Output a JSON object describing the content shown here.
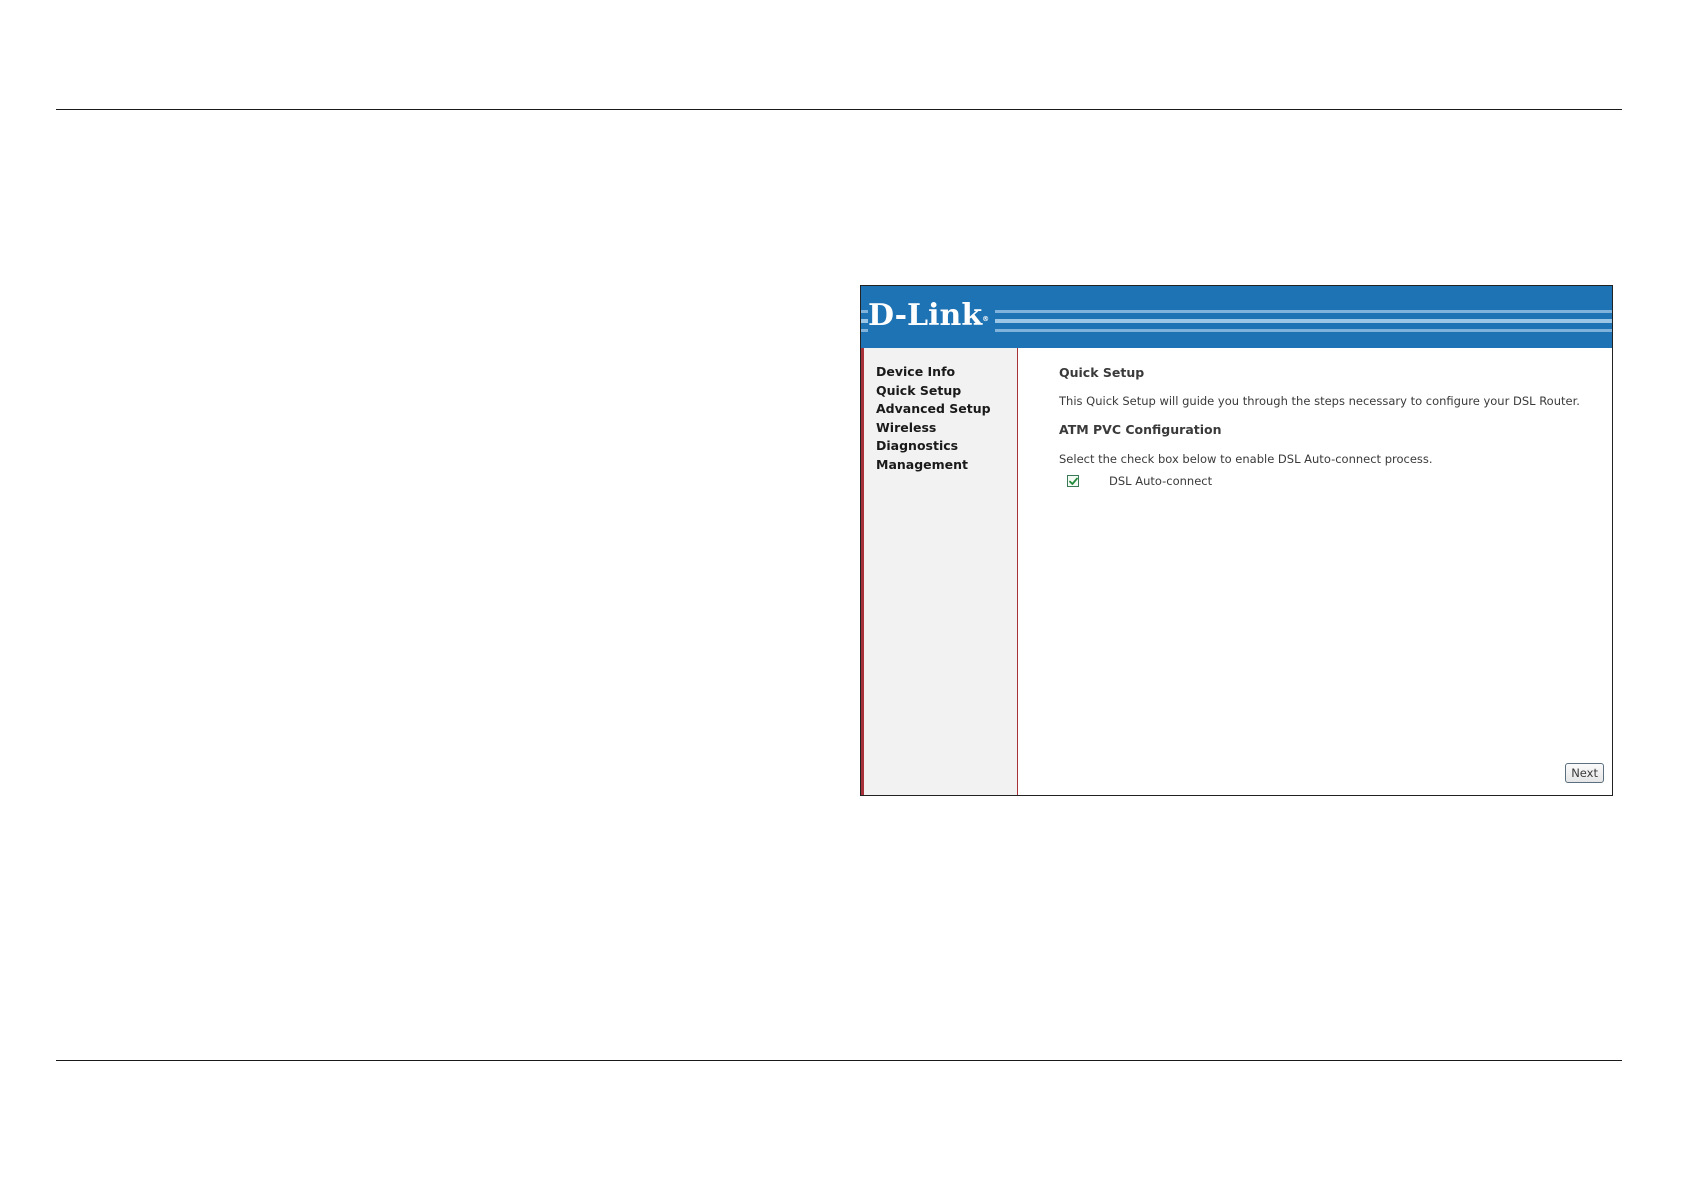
{
  "brand": {
    "logo_text": "D-Link",
    "logo_mark": "®",
    "banner_color": "#1e73b4"
  },
  "sidebar": {
    "items": [
      {
        "label": "Device Info"
      },
      {
        "label": "Quick Setup"
      },
      {
        "label": "Advanced Setup"
      },
      {
        "label": "Wireless"
      },
      {
        "label": "Diagnostics"
      },
      {
        "label": "Management"
      }
    ]
  },
  "main": {
    "title": "Quick Setup",
    "intro": "This Quick Setup will guide you through the steps necessary to configure your DSL Router.",
    "section_title": "ATM PVC Configuration",
    "instruction": "Select the check box below to enable DSL Auto-connect process.",
    "auto_connect": {
      "label": "DSL Auto-connect",
      "checked": true
    },
    "next_label": "Next"
  }
}
